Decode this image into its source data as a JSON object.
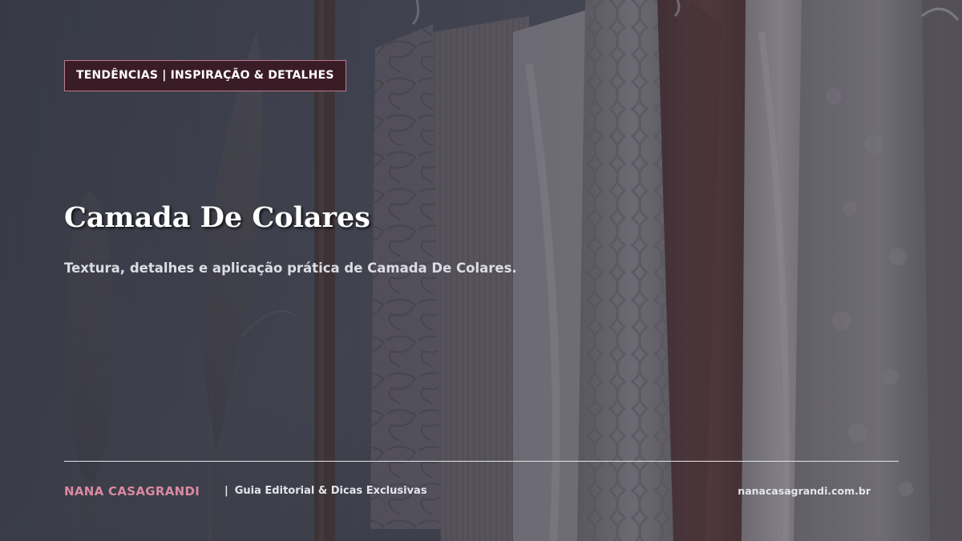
{
  "badge": {
    "label": "TENDÊNCIAS | INSPIRAÇÃO & DETALHES"
  },
  "hero": {
    "title": "Camada De Colares",
    "subtitle": "Textura, detalhes e aplicação prática de Camada De Colares."
  },
  "footer": {
    "brand": "NANA CASAGRANDI",
    "separator": "|",
    "tagline": "Guia Editorial & Dicas Exclusivas",
    "site": "nanacasagrandi.com.br"
  },
  "colors": {
    "background": "#4c4f5c",
    "badge_fill": "#3a1c27",
    "badge_border": "#b87a90",
    "brand_accent": "#d98aa0",
    "text": "#ffffff"
  },
  "background_image": {
    "icon": "clothing-rack-photo",
    "elements": [
      "pampas-grass-stems",
      "wooden-rail-post",
      "hanging-knit-sweaters",
      "burgundy-cardigan",
      "sherpa-coat"
    ]
  }
}
